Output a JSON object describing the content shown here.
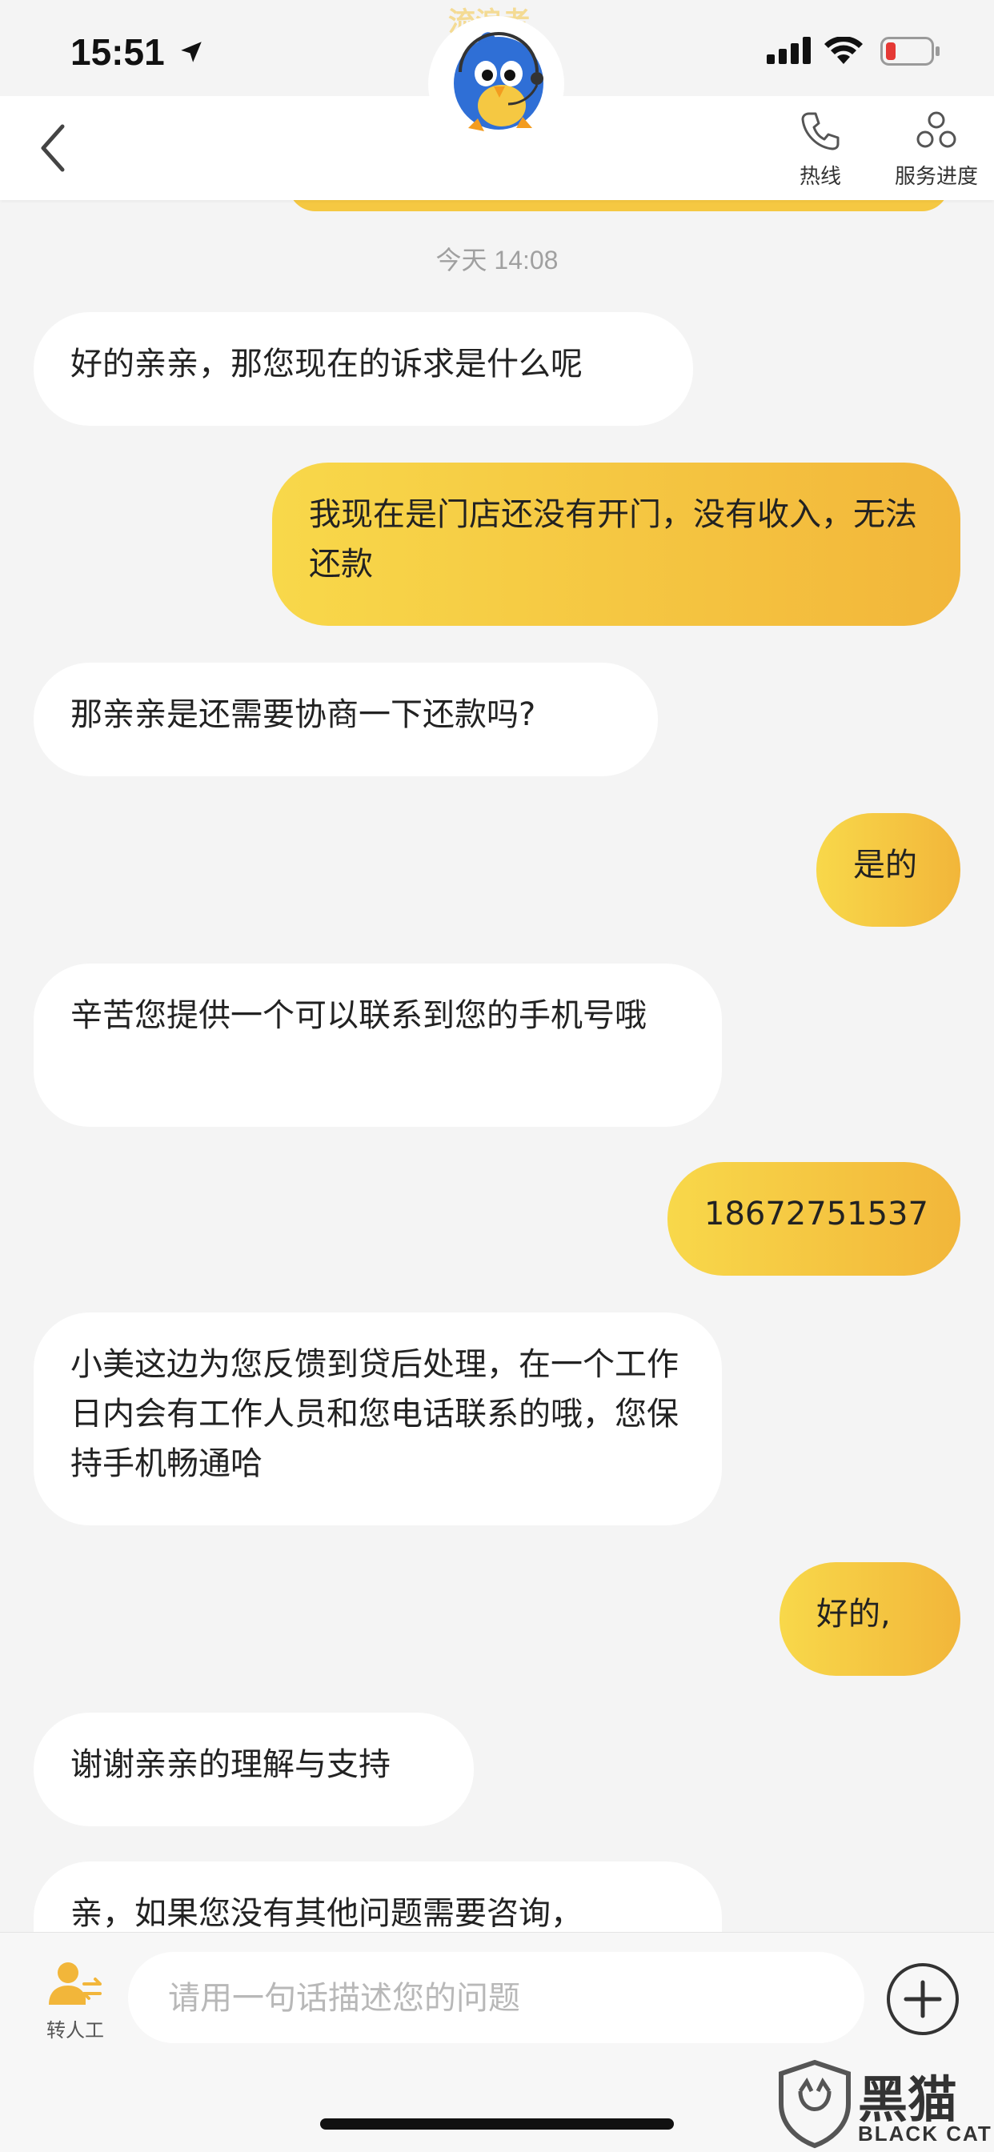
{
  "status_bar": {
    "time": "15:51",
    "watermark": "流浪者",
    "battery_color": "#e53935"
  },
  "header": {
    "hotline_label": "热线",
    "progress_label": "服务进度",
    "accent_color": "#f5c842"
  },
  "chat": {
    "timestamp": "今天 14:08",
    "messages": [
      {
        "sender": "bot",
        "text": "好的亲亲，那您现在的诉求是什么呢"
      },
      {
        "sender": "user",
        "text": "我现在是门店还没有开门，没有收入，无法还款"
      },
      {
        "sender": "bot",
        "text": "那亲亲是还需要协商一下还款吗?"
      },
      {
        "sender": "user",
        "text": "是的"
      },
      {
        "sender": "bot",
        "text": "辛苦您提供一个可以联系到您的手机号哦"
      },
      {
        "sender": "user",
        "text": "18672751537"
      },
      {
        "sender": "bot",
        "text": "小美这边为您反馈到贷后处理，在一个工作日内会有工作人员和您电话联系的哦，您保持手机畅通哈"
      },
      {
        "sender": "user",
        "text": "好的,"
      },
      {
        "sender": "bot",
        "text": "谢谢亲亲的理解与支持"
      },
      {
        "sender": "bot",
        "text": "亲，如果您没有其他问题需要咨询，"
      }
    ]
  },
  "bottom_bar": {
    "transfer_label": "转人工",
    "input_placeholder": "请用一句话描述您的问题"
  },
  "watermark_logo": {
    "cn": "黑猫",
    "en": "BLACK CAT"
  }
}
